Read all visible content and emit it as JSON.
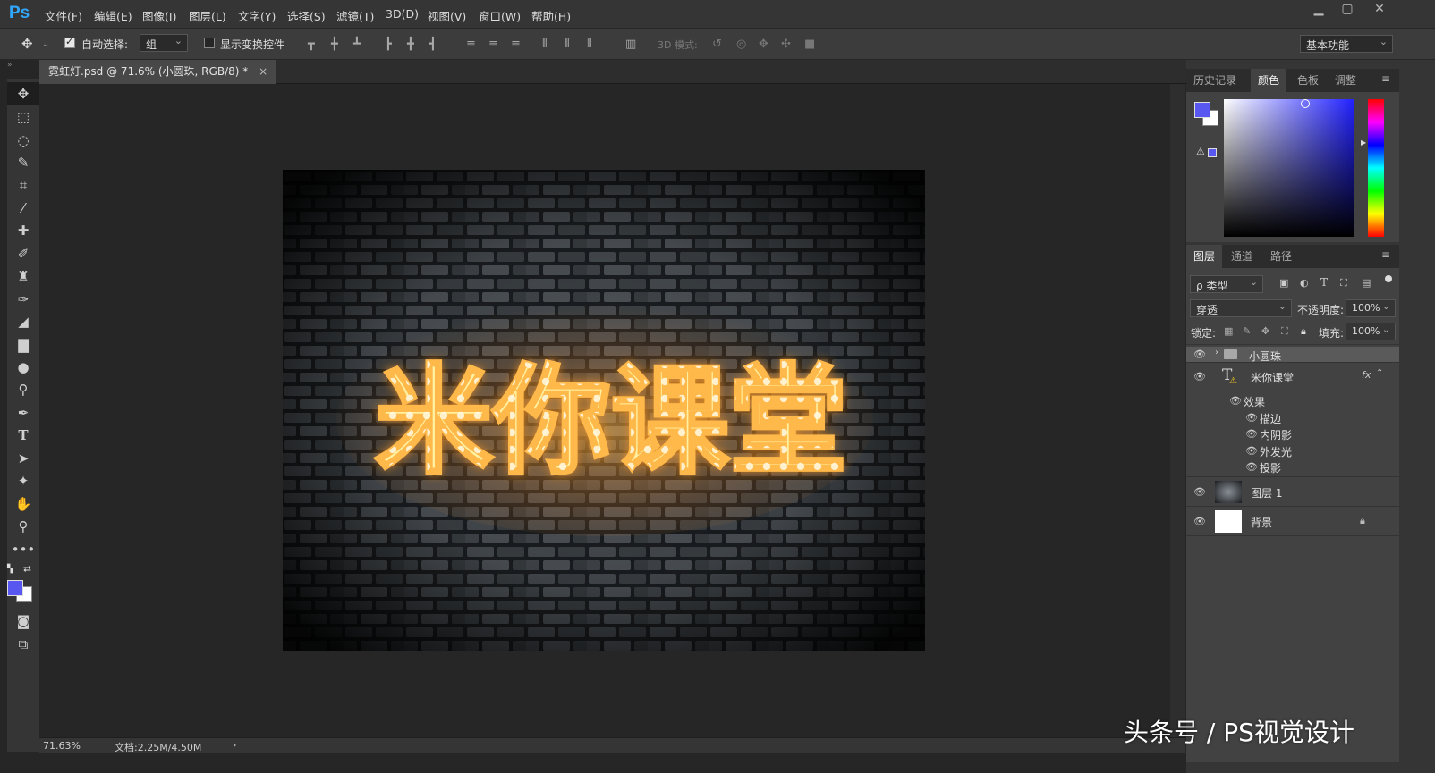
{
  "app": {
    "logo": "Ps"
  },
  "menu": [
    "文件(F)",
    "编辑(E)",
    "图像(I)",
    "图层(L)",
    "文字(Y)",
    "选择(S)",
    "滤镜(T)",
    "3D(D)",
    "视图(V)",
    "窗口(W)",
    "帮助(H)"
  ],
  "window_controls": {
    "minimize": "▁",
    "restore": "▢",
    "close": "✕"
  },
  "options": {
    "auto_select_label": "自动选择:",
    "auto_select_checked": true,
    "auto_select_value": "组",
    "show_transform_label": "显示变换控件",
    "show_transform_checked": false,
    "mode_3d_label": "3D 模式:",
    "workspace": "基本功能"
  },
  "document": {
    "tab_title": "霓虹灯.psd @ 71.6% (小圆珠, RGB/8) *",
    "tab_close": "×",
    "neon_text": "米你课堂"
  },
  "status": {
    "zoom": "71.63%",
    "doc_info": "文档:2.25M/4.50M",
    "arrow": "›"
  },
  "color_panel": {
    "tabs": [
      "历史记录",
      "颜色",
      "色板",
      "调整"
    ],
    "active_tab": "颜色",
    "foreground": "#5858f0",
    "background": "#ffffff"
  },
  "layers_panel": {
    "tabs": [
      "图层",
      "通道",
      "路径"
    ],
    "active_tab": "图层",
    "filter_label": "ρ 类型",
    "blend_mode": "穿透",
    "opacity_label": "不透明度:",
    "opacity_value": "100%",
    "lock_label": "锁定:",
    "fill_label": "填充:",
    "fill_value": "100%",
    "layers": [
      {
        "name": "小圆珠",
        "type": "group"
      },
      {
        "name": "米你课堂",
        "type": "text",
        "fx": "fx"
      },
      {
        "name": "图层 1",
        "type": "image"
      },
      {
        "name": "背景",
        "type": "background"
      }
    ],
    "effects_label": "效果",
    "effects": [
      "描边",
      "内阴影",
      "外发光",
      "投影"
    ]
  },
  "watermark": "头条号 / PS视觉设计"
}
